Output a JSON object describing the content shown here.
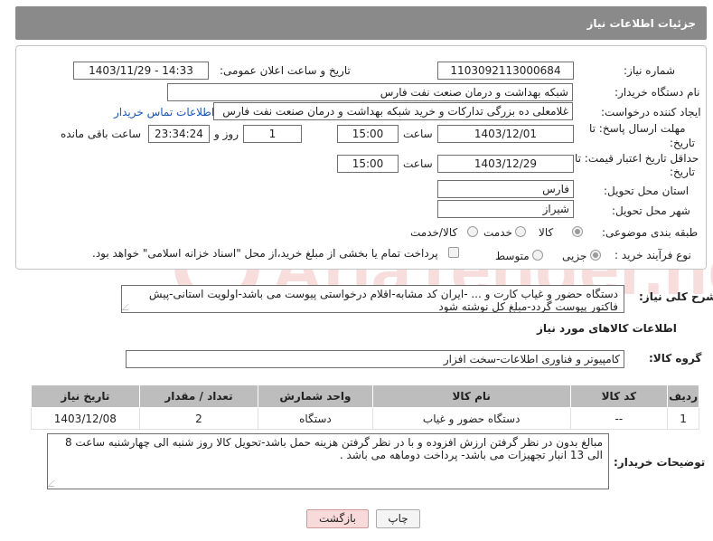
{
  "header": {
    "title": "جزئیات اطلاعات نیاز"
  },
  "fields": {
    "need_number_label": "شماره نیاز:",
    "need_number": "1103092113000684",
    "announce_label": "تاریخ و ساعت اعلان عمومی:",
    "announce_value": "1403/11/29 - 14:33",
    "buyer_label": "نام دستگاه خریدار:",
    "buyer": "شبکه بهداشت و درمان صنعت نفت فارس",
    "creator_label": "ایجاد کننده درخواست:",
    "creator": "غلامعلی ده بزرگی تدارکات و خرید شبکه بهداشت و درمان صنعت نفت فارس",
    "contact_link": "اطلاعات تماس خریدار",
    "deadline_label_1": "مهلت ارسال پاسخ: تا",
    "deadline_label_2": "تاریخ:",
    "deadline_date": "1403/12/01",
    "time_label": "ساعت",
    "deadline_time": "15:00",
    "days_value": "1",
    "days_label": "روز و",
    "remaining_time": "23:34:24",
    "remaining_label": "ساعت باقی مانده",
    "validity_label_1": "حداقل تاریخ اعتبار قیمت: تا",
    "validity_label_2": "تاریخ:",
    "validity_date": "1403/12/29",
    "validity_time": "15:00",
    "province_label": "استان محل تحویل:",
    "province": "فارس",
    "city_label": "شهر محل تحویل:",
    "city": "شیراز",
    "category_label": "طبقه بندی موضوعی:",
    "category_options": [
      "کالا",
      "خدمت",
      "کالا/خدمت"
    ],
    "purchase_type_label": "نوع فرآیند خرید :",
    "purchase_options": [
      "جزیی",
      "متوسط"
    ],
    "payment_note": "پرداخت تمام یا بخشی از مبلغ خرید،از محل \"اسناد خزانه اسلامی\" خواهد بود."
  },
  "description": {
    "label": "شرح کلی نیاز:",
    "text": "دستگاه حضور و غیاب کارت و ... -ایران کد مشابه-اقلام درخواستی پیوست می باشد-اولویت استانی-پیش فاکتور پیوست گردد-مبلغ کل نوشته شود"
  },
  "goods_section": {
    "title": "اطلاعات کالاهای مورد نیاز",
    "group_label": "گروه کالا:",
    "group_value": "کامپیوتر و فناوری اطلاعات-سخت افزار",
    "columns": [
      "ردیف",
      "کد کالا",
      "نام کالا",
      "واحد شمارش",
      "تعداد / مقدار",
      "تاریخ نیاز"
    ],
    "rows": [
      [
        "1",
        "--",
        "دستگاه حضور و غیاب",
        "دستگاه",
        "2",
        "1403/12/08"
      ]
    ]
  },
  "buyer_notes": {
    "label": "توضیحات خریدار:",
    "text": "مبالغ بدون در نظر گرفتن ارزش افزوده و با در نظر گرفتن هزینه حمل باشد-تحویل کالا روز شنبه الی چهارشنبه ساعت 8 الی 13 انبار تجهیزات می باشد- پرداخت دوماهه می باشد ."
  },
  "buttons": {
    "print": "چاپ",
    "back": "بازگشت"
  },
  "watermark": "AriaTender.net",
  "colors": {
    "header_bg": "#8a8a8a",
    "link": "#1a56b8",
    "table_header": "#bdbdbd",
    "back_button": "#f9dada"
  }
}
